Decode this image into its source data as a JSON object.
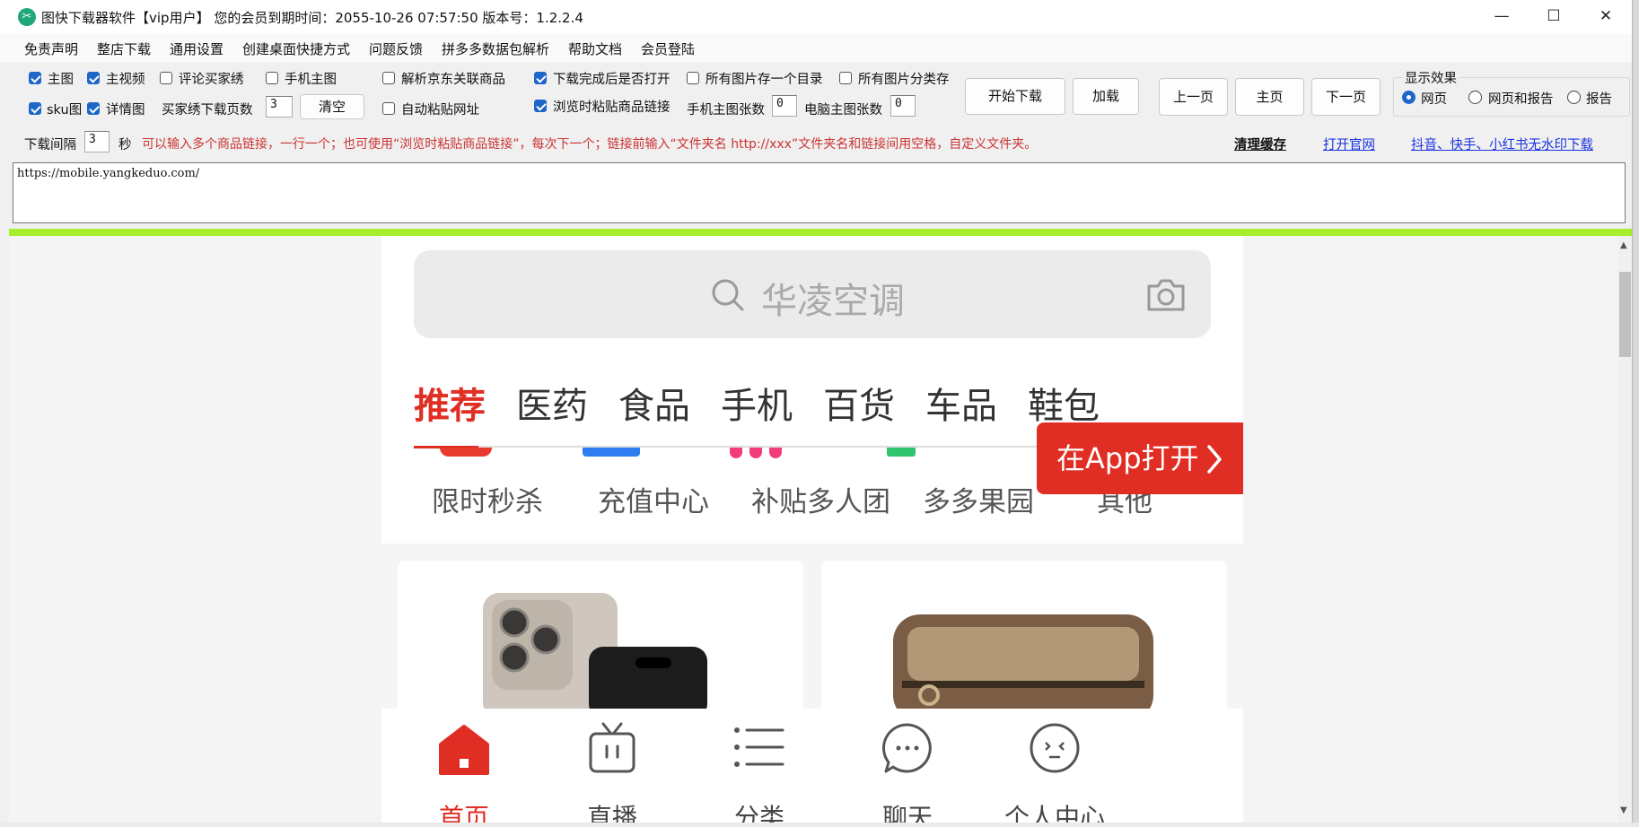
{
  "window": {
    "title": "图快下载器软件【vip用户】 您的会员到期时间：2055-10-26 07:57:50   版本号：1.2.2.4",
    "minimize_glyph": "—",
    "maximize_glyph": "☐",
    "close_glyph": "✕"
  },
  "menu": [
    "免责声明",
    "整店下载",
    "通用设置",
    "创建桌面快捷方式",
    "问题反馈",
    "拼多多数据包解析",
    "帮助文档",
    "会员登陆"
  ],
  "options": {
    "main_image": {
      "label": "主图",
      "checked": true
    },
    "main_video": {
      "label": "主视频",
      "checked": true
    },
    "review_buyer_show": {
      "label": "评论买家绣",
      "checked": false
    },
    "mobile_main_image": {
      "label": "手机主图",
      "checked": false
    },
    "parse_jd_related": {
      "label": "解析京东关联商品",
      "checked": false
    },
    "open_after_download": {
      "label": "下载完成后是否打开",
      "checked": true
    },
    "all_in_one_dir": {
      "label": "所有图片存一个目录",
      "checked": false
    },
    "classify_images": {
      "label": "所有图片分类存",
      "checked": false
    },
    "sku_image": {
      "label": "sku图",
      "checked": true
    },
    "detail_image": {
      "label": "详情图",
      "checked": true
    },
    "buyer_show_pages_label": "买家绣下载页数",
    "buyer_show_pages_value": "3",
    "clear_label": "清空",
    "auto_paste_url": {
      "label": "自动粘贴网址",
      "checked": false
    },
    "paste_while_browsing": {
      "label": "浏览时粘贴商品链接",
      "checked": true
    },
    "mobile_main_count_label": "手机主图张数",
    "mobile_main_count_value": "0",
    "pc_main_count_label": "电脑主图张数",
    "pc_main_count_value": "0",
    "interval_label": "下载间隔",
    "interval_value": "3",
    "interval_unit": "秒",
    "hint": "可以输入多个商品链接，一行一个；也可使用“浏览时粘贴商品链接”，每次下一个；链接前输入“文件夹名 http://xxx”文件夹名和链接间用空格，自定义文件夹。"
  },
  "buttons": {
    "start_download": "开始下载",
    "load": "加载",
    "prev_page": "上一页",
    "home_page": "主页",
    "next_page": "下一页"
  },
  "display": {
    "group_title": "显示效果",
    "options": [
      {
        "label": "网页",
        "selected": true
      },
      {
        "label": "网页和报告",
        "selected": false
      },
      {
        "label": "报告",
        "selected": false
      }
    ]
  },
  "links": {
    "clear_cache": "清理缓存",
    "open_site": "打开官网",
    "no_watermark": "抖音、快手、小红书无水印下载"
  },
  "url_input": {
    "value": "https://mobile.yangkeduo.com/"
  },
  "browser": {
    "search_placeholder": "华凌空调",
    "categories": [
      {
        "label": "推荐",
        "active": true
      },
      {
        "label": "医药",
        "active": false
      },
      {
        "label": "食品",
        "active": false
      },
      {
        "label": "手机",
        "active": false
      },
      {
        "label": "百货",
        "active": false
      },
      {
        "label": "车品",
        "active": false
      },
      {
        "label": "鞋包",
        "active": false
      }
    ],
    "shortcuts": [
      "限时秒杀",
      "充值中心",
      "补贴多人团",
      "多多果园",
      "其他"
    ],
    "open_in_app": "在App打开",
    "tabs": [
      {
        "label": "首页",
        "icon": "home-icon",
        "active": true
      },
      {
        "label": "直播",
        "icon": "tv-icon",
        "active": false
      },
      {
        "label": "分类",
        "icon": "list-icon",
        "active": false
      },
      {
        "label": "聊天",
        "icon": "chat-bubble-icon",
        "active": false
      },
      {
        "label": "个人中心",
        "icon": "face-icon",
        "active": false
      }
    ]
  },
  "colors": {
    "accent_red": "#e02e24",
    "progress_green": "#a5ee2d",
    "checkbox_blue": "#1e66c8",
    "link_blue": "#1a33e0",
    "hint_red": "#cc3333"
  }
}
